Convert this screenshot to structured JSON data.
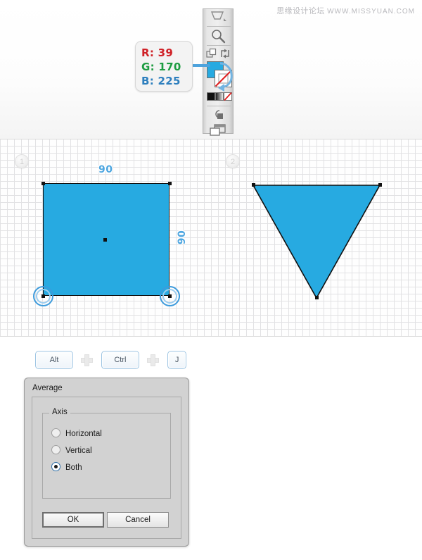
{
  "watermark": {
    "cn": "思缘设计论坛",
    "en": "WWW.MISSYUAN.COM"
  },
  "rgb_callout": {
    "r": "R: 39",
    "g": "G: 170",
    "b": "B: 225",
    "fill_hex": "#27AAE1"
  },
  "toolbar": {
    "items": [
      {
        "name": "gradient-tool",
        "label": "Gradient Tool"
      },
      {
        "name": "zoom-tool",
        "label": "Zoom Tool"
      },
      {
        "name": "change-screen-mode",
        "label": "Change Screen Mode"
      },
      {
        "name": "swap-fill-stroke",
        "label": "Swap Fill and Stroke"
      },
      {
        "name": "fill-swatch",
        "label": "Fill"
      },
      {
        "name": "stroke-swatch-none",
        "label": "Stroke: None"
      },
      {
        "name": "color-gradient-none",
        "label": "Color / Gradient / None"
      },
      {
        "name": "drawing-mode",
        "label": "Drawing Modes"
      },
      {
        "name": "screen-mode",
        "label": "Screen Mode"
      }
    ]
  },
  "canvas": {
    "steps": [
      {
        "number": "1"
      },
      {
        "number": "2"
      }
    ],
    "square": {
      "width_label": "90",
      "height_label": "90"
    }
  },
  "shortcut": {
    "keys": [
      "Alt",
      "Ctrl",
      "J"
    ],
    "separator": "+"
  },
  "dialog": {
    "title": "Average",
    "group_legend": "Axis",
    "options": [
      {
        "label": "Horizontal",
        "selected": false
      },
      {
        "label": "Vertical",
        "selected": false
      },
      {
        "label": "Both",
        "selected": true
      }
    ],
    "ok_label": "OK",
    "cancel_label": "Cancel"
  }
}
